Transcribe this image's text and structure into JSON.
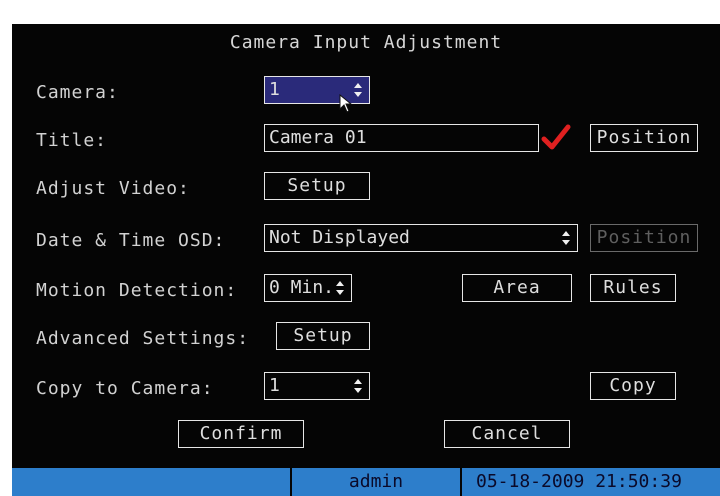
{
  "dialog": {
    "title": "Camera Input Adjustment",
    "camera": {
      "label": "Camera:",
      "value": "1"
    },
    "title_row": {
      "label": "Title:",
      "value": "Camera 01",
      "enabled": true,
      "position_label": "Position"
    },
    "adjust_video": {
      "label": "Adjust Video:",
      "button": "Setup"
    },
    "date_time_osd": {
      "label": "Date & Time OSD:",
      "value": "Not Displayed",
      "position_label": "Position"
    },
    "motion_detection": {
      "label": "Motion Detection:",
      "value": "0 Min.",
      "area_label": "Area",
      "rules_label": "Rules"
    },
    "advanced_settings": {
      "label": "Advanced Settings:",
      "button": "Setup"
    },
    "copy_to_camera": {
      "label": "Copy to Camera:",
      "value": "1",
      "copy_label": "Copy"
    },
    "confirm_label": "Confirm",
    "cancel_label": "Cancel"
  },
  "status_bar": {
    "user": "admin",
    "datetime": "05-18-2009 21:50:39"
  },
  "colors": {
    "background": "#050505",
    "text": "#d6d6d6",
    "status_bar": "#2d7ecb",
    "check": "#e02020",
    "selected_field": "#2a2a7a"
  },
  "icons": {
    "spinner": "up-down-arrows-icon",
    "check": "checkmark-icon",
    "cursor": "mouse-pointer-icon"
  }
}
